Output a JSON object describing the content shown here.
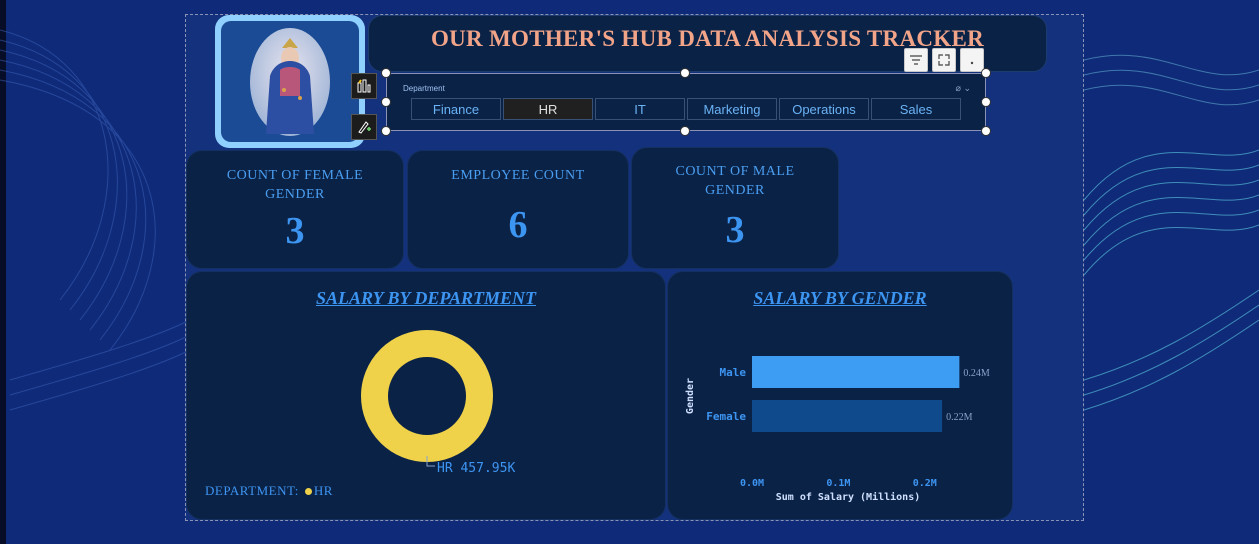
{
  "header": {
    "title": "OUR MOTHER'S HUB DATA ANALYSIS TRACKER"
  },
  "logo": {
    "icon": "virgin-mary-portrait"
  },
  "slicer": {
    "label": "Department",
    "options": [
      "Finance",
      "HR",
      "IT",
      "Marketing",
      "Operations",
      "Sales"
    ],
    "selected": "HR"
  },
  "kpis": {
    "female": {
      "label_line1": "COUNT OF FEMALE",
      "label_line2": "GENDER",
      "value": "3"
    },
    "employees": {
      "label": "EMPLOYEE COUNT",
      "value": "6"
    },
    "male": {
      "label_line1": "COUNT OF MALE",
      "label_line2": "GENDER",
      "value": "3"
    }
  },
  "colors": {
    "background": "#0f2a78",
    "card": "#0b2247",
    "accent": "#3d95f2",
    "title": "#f1a488",
    "donut": "#efd24a",
    "bar_male": "#3d9df2",
    "bar_female": "#0f4a8c"
  },
  "salary_by_department": {
    "title": "SALARY BY DEPARTMENT",
    "legend_title": "DEPARTMENT:",
    "data_label": "HR 457.95K",
    "chart_data": {
      "type": "pie",
      "categories": [
        "HR"
      ],
      "values": [
        457950
      ],
      "title": "SALARY BY DEPARTMENT",
      "legend": [
        "HR"
      ]
    }
  },
  "salary_by_gender": {
    "title": "SALARY BY GENDER",
    "chart_data": {
      "type": "bar",
      "orientation": "horizontal",
      "categories": [
        "Male",
        "Female"
      ],
      "values": [
        0.24,
        0.22
      ],
      "data_labels": [
        "0.24M",
        "0.22M"
      ],
      "title": "SALARY BY GENDER",
      "xlabel": "Sum of Salary (Millions)",
      "ylabel": "Gender",
      "xticks": [
        "0.0M",
        "0.1M",
        "0.2M"
      ],
      "xlim": [
        0,
        0.25
      ]
    }
  }
}
